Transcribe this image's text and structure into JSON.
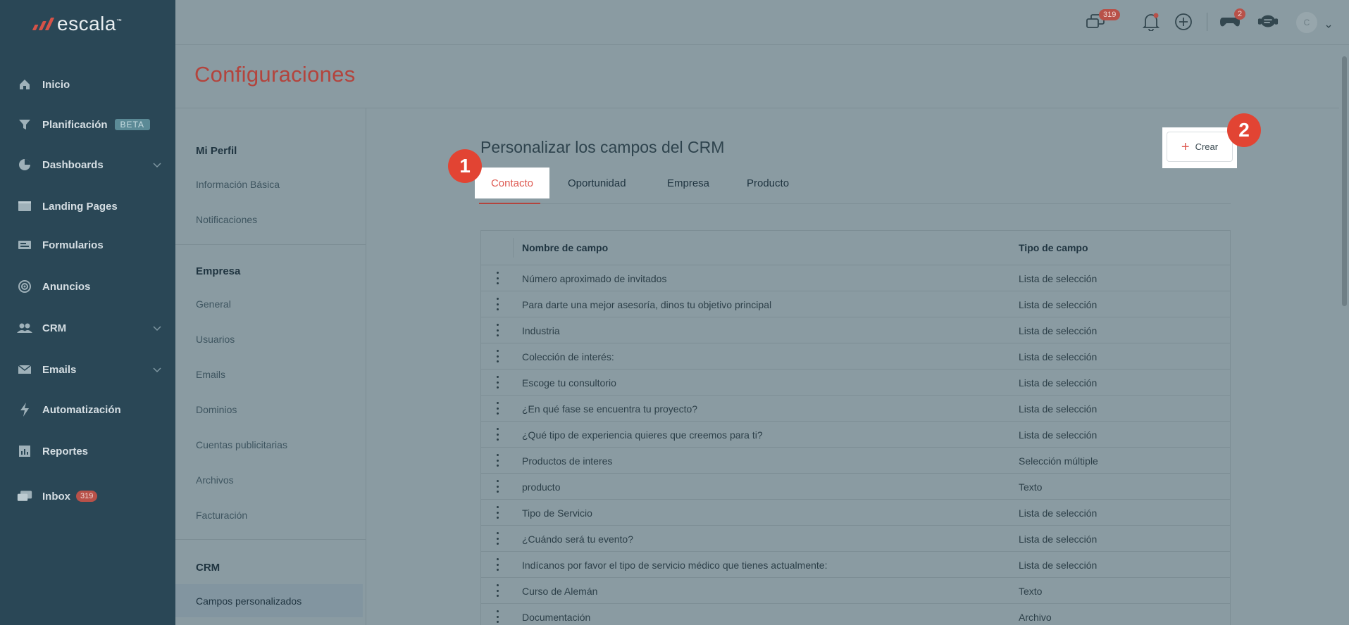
{
  "brand": {
    "name": "escala",
    "tm": "™"
  },
  "sidebar": {
    "items": [
      {
        "label": "Inicio",
        "icon": "home-icon"
      },
      {
        "label": "Planificación",
        "icon": "filter-icon",
        "badge": "BETA"
      },
      {
        "label": "Dashboards",
        "icon": "pie-chart-icon",
        "expandable": true
      },
      {
        "label": "Landing Pages",
        "icon": "browser-icon"
      },
      {
        "label": "Formularios",
        "icon": "form-icon"
      },
      {
        "label": "Anuncios",
        "icon": "target-icon"
      },
      {
        "label": "CRM",
        "icon": "people-icon",
        "expandable": true
      },
      {
        "label": "Emails",
        "icon": "mail-icon",
        "expandable": true
      },
      {
        "label": "Automatización",
        "icon": "bolt-icon"
      },
      {
        "label": "Reportes",
        "icon": "report-icon"
      },
      {
        "label": "Inbox",
        "icon": "inbox-icon",
        "count": "319"
      }
    ]
  },
  "topbar": {
    "messages_count": "319",
    "gamepad_count": "2",
    "avatar_initial": "C"
  },
  "page": {
    "title": "Configuraciones"
  },
  "settings_nav": {
    "sections": [
      {
        "heading": "Mi Perfil",
        "items": [
          "Información Básica",
          "Notificaciones"
        ]
      },
      {
        "heading": "Empresa",
        "items": [
          "General",
          "Usuarios",
          "Emails",
          "Dominios",
          "Cuentas publicitarias",
          "Archivos",
          "Facturación"
        ]
      },
      {
        "heading": "CRM",
        "items": [
          "Campos personalizados"
        ]
      }
    ]
  },
  "main": {
    "title": "Personalizar los campos del CRM",
    "create_label": "Crear",
    "tabs": [
      "Contacto",
      "Oportunidad",
      "Empresa",
      "Producto"
    ],
    "step_markers": [
      "1",
      "2"
    ]
  },
  "table": {
    "columns": [
      "Nombre de campo",
      "Tipo de campo"
    ],
    "rows": [
      [
        "Número aproximado de invitados",
        "Lista de selección"
      ],
      [
        "Para darte una mejor asesoría, dinos tu objetivo principal",
        "Lista de selección"
      ],
      [
        "Industria",
        "Lista de selección"
      ],
      [
        "Colección de interés:",
        "Lista de selección"
      ],
      [
        "Escoge tu consultorio",
        "Lista de selección"
      ],
      [
        "¿En qué fase se encuentra tu proyecto?",
        "Lista de selección"
      ],
      [
        "¿Qué tipo de experiencia quieres que creemos para ti?",
        "Lista de selección"
      ],
      [
        "Productos de interes",
        "Selección múltiple"
      ],
      [
        "producto",
        "Texto"
      ],
      [
        "Tipo de Servicio",
        "Lista de selección"
      ],
      [
        "¿Cuándo será tu evento?",
        "Lista de selección"
      ],
      [
        "Indícanos por favor el tipo de servicio médico que tienes actualmente:",
        "Lista de selección"
      ],
      [
        "Curso de Alemán",
        "Texto"
      ],
      [
        "Documentación",
        "Archivo"
      ]
    ]
  }
}
